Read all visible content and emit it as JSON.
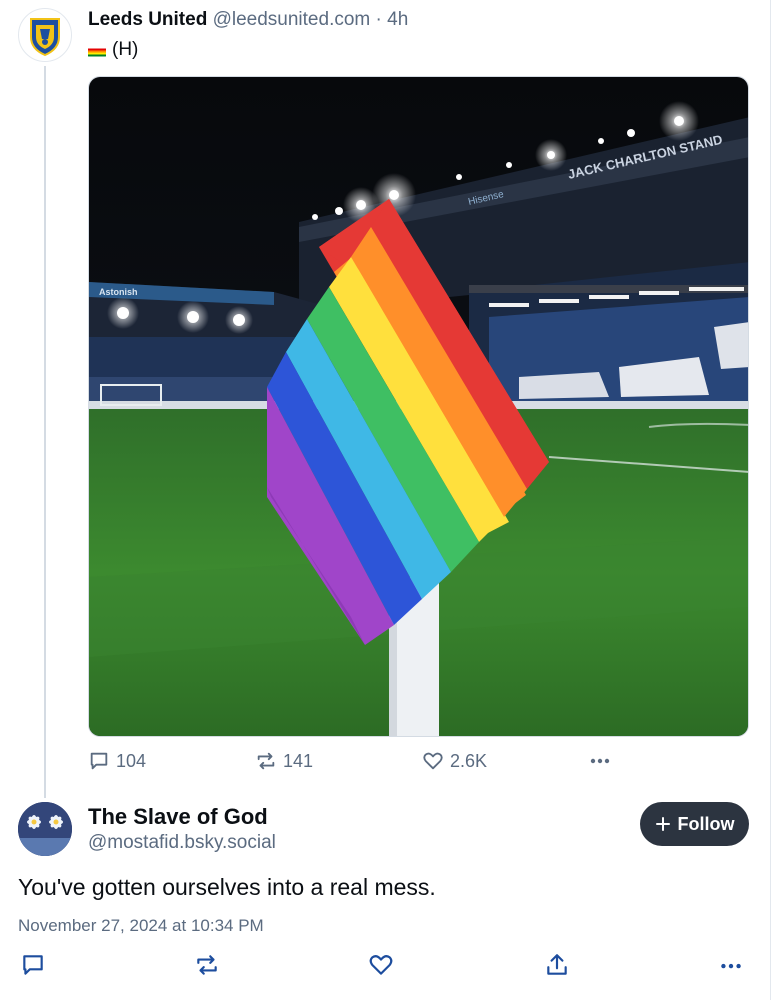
{
  "post": {
    "author_name": "Leeds United",
    "author_handle": "@leedsunited.com",
    "separator": "·",
    "time_ago": "4h",
    "text": "(H)",
    "emoji": "rainbow-flag",
    "image_description_icons": [
      "corner-flag-photo"
    ],
    "stadium_signs": [
      "JACK CHARLTON STAND",
      "Astonish",
      "Hisense"
    ],
    "actions": {
      "replies": "104",
      "reposts": "141",
      "likes": "2.6K"
    }
  },
  "reply": {
    "author_name": "The Slave of God",
    "author_handle": "@mostafid.bsky.social",
    "follow_label": "Follow",
    "text": "You've gotten ourselves into a real mess.",
    "timestamp": "November 27, 2024 at 10:34 PM"
  },
  "colors": {
    "text_primary": "#0b0f14",
    "text_muted": "#5b6b80",
    "follow_bg": "#2c3440",
    "thread_line": "#d4dbe3"
  }
}
